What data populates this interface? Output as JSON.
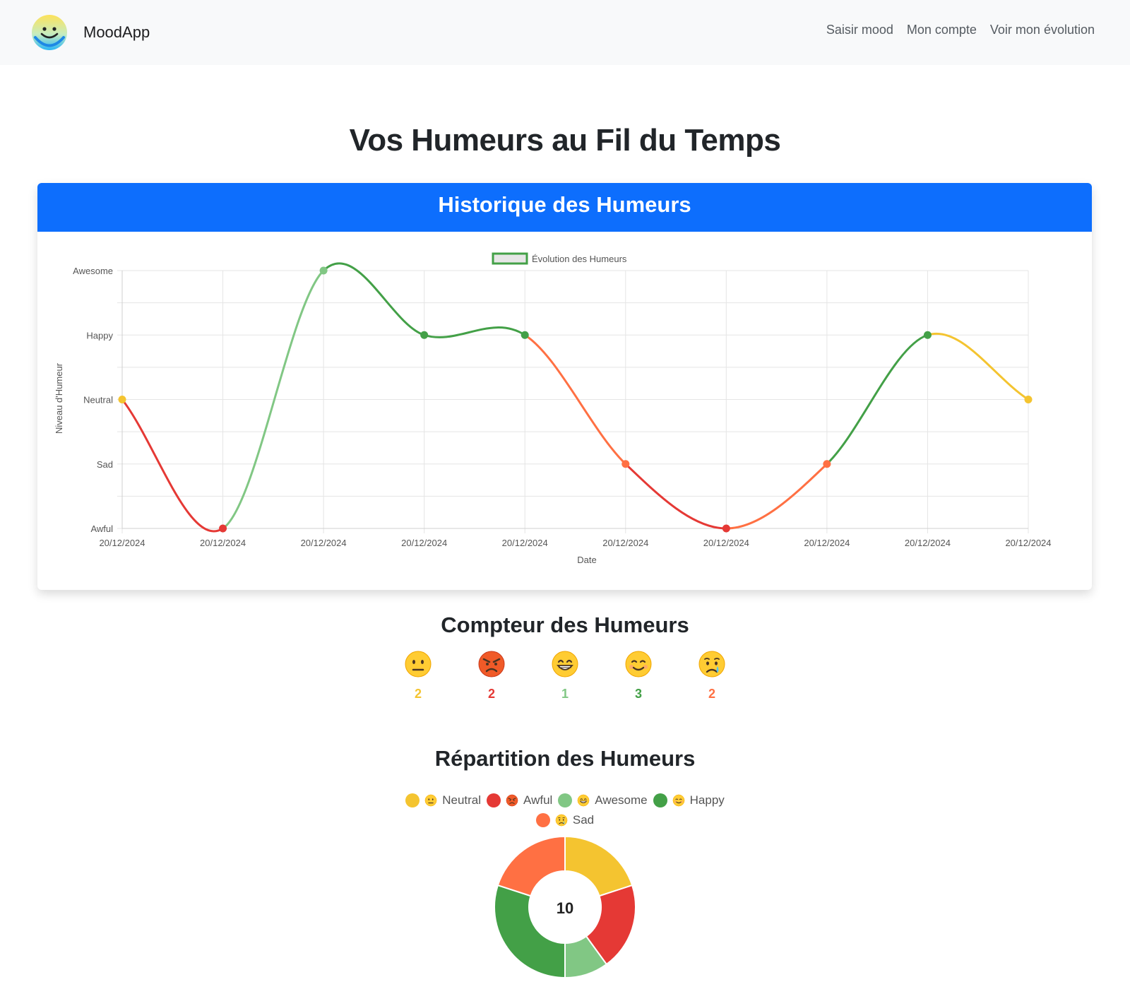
{
  "navbar": {
    "brand": "MoodApp",
    "links": [
      {
        "label": "Saisir mood"
      },
      {
        "label": "Mon compte"
      },
      {
        "label": "Voir mon évolution"
      }
    ]
  },
  "page_title": "Vos Humeurs au Fil du Temps",
  "history_card": {
    "title": "Historique des Humeurs"
  },
  "counter": {
    "title": "Compteur des Humeurs",
    "items": [
      {
        "mood": "Neutral",
        "face": "neutral",
        "count": "2",
        "color": "#f4c430"
      },
      {
        "mood": "Awful",
        "face": "angry",
        "count": "2",
        "color": "#e53935"
      },
      {
        "mood": "Awesome",
        "face": "grin",
        "count": "1",
        "color": "#81c784"
      },
      {
        "mood": "Happy",
        "face": "smile",
        "count": "3",
        "color": "#43a047"
      },
      {
        "mood": "Sad",
        "face": "cry",
        "count": "2",
        "color": "#ff7043"
      }
    ]
  },
  "distribution": {
    "title": "Répartition des Humeurs",
    "center_total": "10"
  },
  "chart_data": [
    {
      "type": "line",
      "legend": [
        "Évolution des Humeurs"
      ],
      "legend_position": "top-center",
      "xlabel": "Date",
      "ylabel": "Niveau d'Humeur",
      "y_ticks": [
        "Awful",
        "Sad",
        "Neutral",
        "Happy",
        "Awesome"
      ],
      "ylim": [
        1,
        5
      ],
      "grid": true,
      "x": [
        "20/12/2024",
        "20/12/2024",
        "20/12/2024",
        "20/12/2024",
        "20/12/2024",
        "20/12/2024",
        "20/12/2024",
        "20/12/2024",
        "20/12/2024",
        "20/12/2024"
      ],
      "series": [
        {
          "name": "Évolution des Humeurs",
          "values": [
            3,
            1,
            5,
            4,
            4,
            2,
            1,
            2,
            4,
            3
          ],
          "point_colors": [
            "#f4c430",
            "#e53935",
            "#81c784",
            "#43a047",
            "#43a047",
            "#ff7043",
            "#e53935",
            "#ff7043",
            "#43a047",
            "#f4c430"
          ]
        }
      ]
    },
    {
      "type": "pie",
      "variant": "doughnut",
      "legend_position": "top",
      "categories": [
        "😐 Neutral",
        "😡 Awful",
        "😁 Awesome",
        "😊 Happy",
        "😢 Sad"
      ],
      "faces": [
        "neutral",
        "angry",
        "grin",
        "smile",
        "cry"
      ],
      "values": [
        2,
        2,
        1,
        3,
        2
      ],
      "colors": [
        "#f4c430",
        "#e53935",
        "#81c784",
        "#43a047",
        "#ff7043"
      ]
    }
  ]
}
